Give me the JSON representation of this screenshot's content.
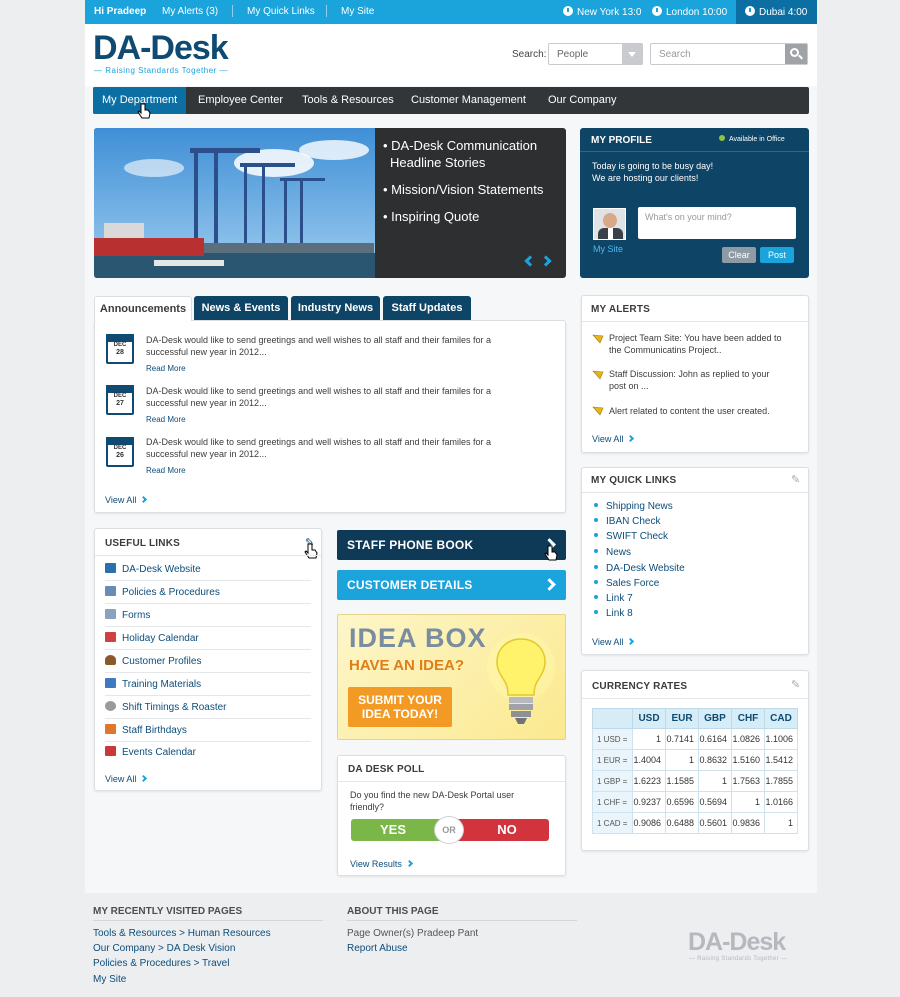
{
  "topbar": {
    "greeting": "Hi Pradeep",
    "links": [
      "My Alerts (3)",
      "My Quick Links",
      "My Site"
    ],
    "clocks": [
      "New York 13:0",
      "London 10:00",
      "Dubai 4:00"
    ]
  },
  "brand": {
    "name": "DA-Desk",
    "tagline": "— Raising Standards Together —"
  },
  "search": {
    "label": "Search:",
    "scope": "People",
    "placeholder": "Search"
  },
  "nav": [
    "My Department",
    "Employee Center",
    "Tools & Resources",
    "Customer Management",
    "Our Company"
  ],
  "hero": {
    "bullets": [
      "• DA-Desk Communication",
      "Headline Stories",
      "• Mission/Vision Statements",
      "• Inspiring Quote"
    ]
  },
  "profile": {
    "title": "MY PROFILE",
    "status": "Available in Office",
    "message_line1": "Today is going to be busy day!",
    "message_line2": "We are hosting our clients!",
    "mysite": "My Site",
    "placeholder": "What's on your mind?",
    "clear": "Clear",
    "post": "Post"
  },
  "tabs": [
    "Announcements",
    "News & Events",
    "Industry News",
    "Staff Updates"
  ],
  "announcements": [
    {
      "month": "DEC",
      "day": "28",
      "line1": "DA-Desk would like to send greetings and well wishes to all staff and their familes for a",
      "line2": "successful new year in 2012...",
      "more": "Read More"
    },
    {
      "month": "DEC",
      "day": "27",
      "line1": "DA-Desk  would like to send greetings and well wishes to all staff and their familes for a",
      "line2": "successful new year in 2012...",
      "more": "Read More"
    },
    {
      "month": "DEC",
      "day": "26",
      "line1": "DA-Desk would like to send greetings and well wishes to all staff and their familes for a",
      "line2": "successful new year in 2012...",
      "more": "Read More"
    }
  ],
  "view_all": "View All",
  "alerts": {
    "title": "MY ALERTS",
    "items": [
      {
        "l1": "Project Team Site: You have been added to",
        "l2": "the Communicatins Project.."
      },
      {
        "l1": "Staff Discussion: John as replied to your",
        "l2": "post on ..."
      },
      {
        "l1": "Alert related to content the user created.",
        "l2": ""
      }
    ]
  },
  "quicklinks": {
    "title": "MY QUICK LINKS",
    "items": [
      "Shipping News",
      "IBAN Check",
      "SWIFT Check",
      "News",
      "DA-Desk Website",
      "Sales Force",
      "Link 7",
      "Link 8"
    ]
  },
  "useful": {
    "title": "USEFUL LINKS",
    "items": [
      {
        "label": "DA-Desk Website",
        "color": "#2a6fb0"
      },
      {
        "label": "Policies & Procedures",
        "color": "#6a8bb3"
      },
      {
        "label": "Forms",
        "color": "#8aa2bd"
      },
      {
        "label": "Holiday Calendar",
        "color": "#d04040"
      },
      {
        "label": "Customer Profiles",
        "color": "#8a5a2b"
      },
      {
        "label": "Training Materials",
        "color": "#3d7ac0"
      },
      {
        "label": "Shift Timings & Roaster",
        "color": "#9a9a9a"
      },
      {
        "label": "Staff Birthdays",
        "color": "#e0762a"
      },
      {
        "label": "Events Calendar",
        "color": "#c83a3a"
      }
    ]
  },
  "buttons": {
    "phonebook": "STAFF PHONE BOOK",
    "customer": "CUSTOMER DETAILS"
  },
  "ideabox": {
    "title": "IDEA BOX",
    "sub": "HAVE AN IDEA?",
    "cta1": "SUBMIT YOUR",
    "cta2": "IDEA TODAY!"
  },
  "poll": {
    "title": "DA DESK POLL",
    "q1": "Do you find the new DA-Desk Portal user",
    "q2": "friendly?",
    "yes": "YES",
    "or": "OR",
    "no": "NO",
    "results": "View Results"
  },
  "currency": {
    "title": "CURRENCY RATES",
    "cols": [
      "USD",
      "EUR",
      "GBP",
      "CHF",
      "CAD"
    ],
    "rows": [
      {
        "label": "1 USD =",
        "vals": [
          "1",
          "0.7141",
          "0.6164",
          "1.0826",
          "1.1006"
        ]
      },
      {
        "label": "1 EUR =",
        "vals": [
          "1.4004",
          "1",
          "0.8632",
          "1.5160",
          "1.5412"
        ]
      },
      {
        "label": "1 GBP =",
        "vals": [
          "1.6223",
          "1.1585",
          "1",
          "1.7563",
          "1.7855"
        ]
      },
      {
        "label": "1 CHF =",
        "vals": [
          "0.9237",
          "0.6596",
          "0.5694",
          "1",
          "1.0166"
        ]
      },
      {
        "label": "1 CAD =",
        "vals": [
          "0.9086",
          "0.6488",
          "0.5601",
          "0.9836",
          "1"
        ]
      }
    ]
  },
  "footer": {
    "recent_title": "MY RECENTLY VISITED PAGES",
    "recent": [
      "Tools & Resources > Human Resources",
      "Our Company > DA Desk Vision",
      "Policies & Procedures > Travel",
      "My Site"
    ],
    "about_title": "ABOUT THIS PAGE",
    "owner": "Page Owner(s)  Pradeep Pant",
    "report": "Report Abuse"
  }
}
